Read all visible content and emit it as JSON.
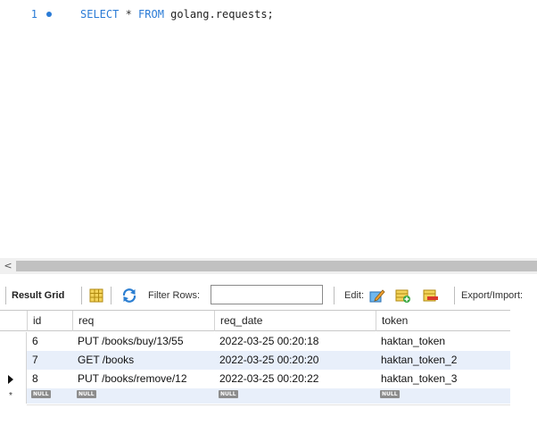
{
  "editor": {
    "line_number": "1",
    "code": {
      "kw_select": "SELECT",
      "star": " * ",
      "kw_from": "FROM",
      "table": " golang.requests;"
    }
  },
  "scrollbar": {
    "left_arrow": "<"
  },
  "toolbar": {
    "result_grid_label": "Result Grid",
    "filter_rows_label": "Filter Rows:",
    "filter_rows_value": "",
    "edit_label": "Edit:",
    "export_label": "Export/Import:"
  },
  "grid": {
    "columns": [
      "id",
      "req",
      "req_date",
      "token"
    ],
    "rows": [
      {
        "id": "6",
        "req": "PUT /books/buy/13/55",
        "req_date": "2022-03-25 00:20:18",
        "token": "haktan_token"
      },
      {
        "id": "7",
        "req": "GET /books",
        "req_date": "2022-03-25 00:20:20",
        "token": "haktan_token_2"
      },
      {
        "id": "8",
        "req": "PUT /books/remove/12",
        "req_date": "2022-03-25 00:20:22",
        "token": "haktan_token_3"
      }
    ],
    "null_label": "NULL",
    "selected_row_index": 2
  },
  "colors": {
    "keyword": "#2a7bd6",
    "row_alt": "#e8effa",
    "null_badge": "#8c8c8c"
  }
}
